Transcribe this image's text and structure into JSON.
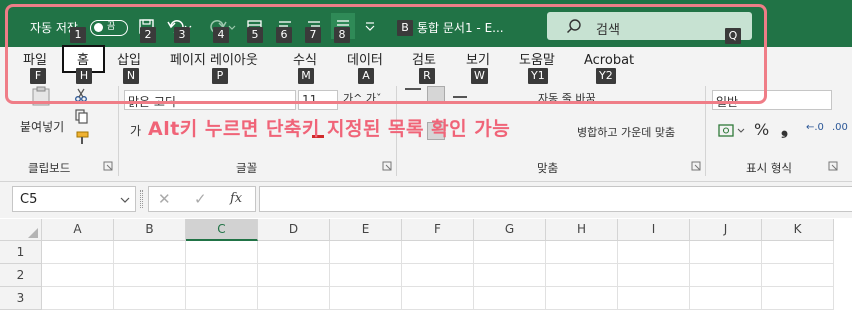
{
  "colors": {
    "excel_green": "#217346",
    "highlight": "#ef7d87",
    "callout": "#f06478",
    "keytip_bg": "#3a3a3a"
  },
  "titlebar": {
    "autosave_label": "자동 저장",
    "autosave_state": "끔",
    "doc_title": "통합 문서1  -  E...",
    "search_placeholder": "검색",
    "qat_icons": [
      "save-icon",
      "undo-icon",
      "redo-icon",
      "qat-icon-5",
      "qat-icon-6",
      "qat-icon-7",
      "qat-icon-8",
      "customize-qat-icon"
    ]
  },
  "keytips": {
    "qat_1": "1",
    "qat_2": "2",
    "qat_3": "3",
    "qat_4": "4",
    "qat_5": "5",
    "qat_6": "6",
    "qat_7": "7",
    "qat_8": "8",
    "doc": "B",
    "search": "Q",
    "file": "F",
    "home": "H",
    "insert": "N",
    "page_layout": "P",
    "formulas": "M",
    "data": "A",
    "review": "R",
    "view": "W",
    "help": "Y1",
    "acrobat": "Y2"
  },
  "tabs": {
    "file": "파일",
    "home": "홈",
    "insert": "삽입",
    "page_layout": "페이지 레이아웃",
    "formulas": "수식",
    "data": "데이터",
    "review": "검토",
    "view": "보기",
    "help": "도움말",
    "acrobat": "Acrobat"
  },
  "ribbon": {
    "paste_label": "붙여넣기",
    "font_name": "맑은 고딕",
    "font_size": "11",
    "wrap_text": "자동 줄 바꿈",
    "merge_center": "병합하고 가운데 맞춤",
    "number_format": "일반",
    "group_clipboard": "클립보드",
    "group_font": "글꼴",
    "group_alignment": "맞춤",
    "group_number": "표시 형식",
    "percent": "%",
    "comma": "❟",
    "dec_inc": "←.0",
    "dec_dec": ".00"
  },
  "callout": "Alt키 누르면 단축키 지정된 목록 확인 가능",
  "formula_bar": {
    "name_box": "C5",
    "cancel": "✕",
    "enter": "✓",
    "fx": "fx",
    "value": ""
  },
  "grid": {
    "columns": [
      "A",
      "B",
      "C",
      "D",
      "E",
      "F",
      "G",
      "H",
      "I",
      "J",
      "K"
    ],
    "rows": [
      "1",
      "2",
      "3"
    ],
    "selected_column": "C"
  }
}
